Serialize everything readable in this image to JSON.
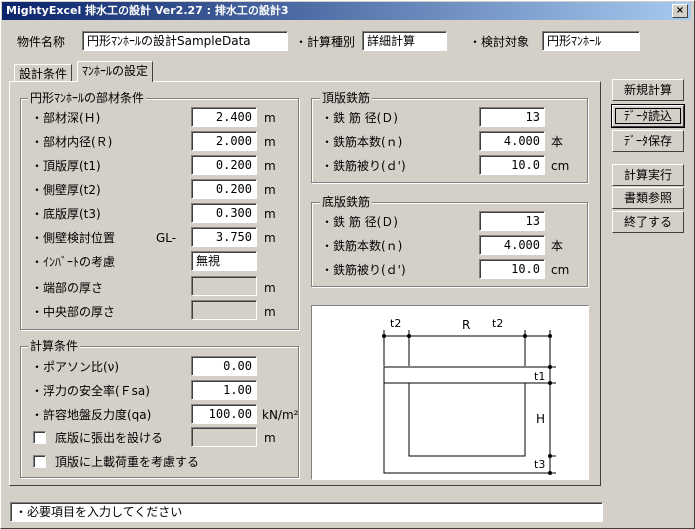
{
  "window": {
    "title": "MightyExcel 排水工の設計 Ver2.27 : 排水工の設計3",
    "close_glyph": "×"
  },
  "header": {
    "property_label": "物件名称",
    "property_value": "円形ﾏﾝﾎｰﾙの設計SampleData",
    "calc_type_label": "・計算種別",
    "calc_type_value": "詳細計算",
    "target_label": "・検討対象",
    "target_value": "円形ﾏﾝﾎｰﾙ"
  },
  "tabs": [
    {
      "label": "設計条件",
      "active": false
    },
    {
      "label": "ﾏﾝﾎｰﾙの設定",
      "active": true
    }
  ],
  "member_group": {
    "title": "円形ﾏﾝﾎｰﾙの部材条件",
    "rows": [
      {
        "label": "・部材深(Ｈ)",
        "value": "2.400",
        "unit": "m"
      },
      {
        "label": "・部材内径(Ｒ)",
        "value": "2.000",
        "unit": "m"
      },
      {
        "label": "・頂版厚(t1)",
        "value": "0.200",
        "unit": "m"
      },
      {
        "label": "・側壁厚(t2)",
        "value": "0.200",
        "unit": "m"
      },
      {
        "label": "・底版厚(t3)",
        "value": "0.300",
        "unit": "m"
      },
      {
        "label": "・側壁検討位置",
        "prefix": "GL-",
        "value": "3.750",
        "unit": "m"
      },
      {
        "label": "・ｲﾝﾊﾞｰﾄの考慮",
        "value": "無視",
        "unit": ""
      },
      {
        "label": "・端部の厚さ",
        "value": "",
        "unit": "m"
      },
      {
        "label": "・中央部の厚さ",
        "value": "",
        "unit": "m"
      }
    ]
  },
  "calc_group": {
    "title": "計算条件",
    "rows": [
      {
        "label": "・ポアソン比(ν)",
        "value": "0.00",
        "unit": ""
      },
      {
        "label": "・浮力の安全率(Ｆsa)",
        "value": "1.00",
        "unit": ""
      },
      {
        "label": "・許容地盤反力度(qa)",
        "value": "100.00",
        "unit": "kN/m²"
      }
    ],
    "check1_label": "底版に張出を設ける",
    "check1_unit": "m",
    "check2_label": "頂版に上載荷重を考慮する"
  },
  "top_rebar": {
    "title": "頂版鉄筋",
    "rows": [
      {
        "label": "・鉄 筋 径(Ｄ)",
        "value": "13",
        "unit": ""
      },
      {
        "label": "・鉄筋本数(ｎ)",
        "value": "4.000",
        "unit": "本"
      },
      {
        "label": "・鉄筋被り(ｄ')",
        "value": "10.0",
        "unit": "cm"
      }
    ]
  },
  "bottom_rebar": {
    "title": "底版鉄筋",
    "rows": [
      {
        "label": "・鉄 筋 径(Ｄ)",
        "value": "13",
        "unit": ""
      },
      {
        "label": "・鉄筋本数(ｎ)",
        "value": "4.000",
        "unit": "本"
      },
      {
        "label": "・鉄筋被り(ｄ')",
        "value": "10.0",
        "unit": "cm"
      }
    ]
  },
  "diagram": {
    "t1": "t1",
    "t2_left": "t2",
    "t2_right": "t2",
    "t3": "t3",
    "R": "R",
    "H": "H"
  },
  "buttons": {
    "new_calc": "新規計算",
    "load_data": "ﾃﾞｰﾀ読込",
    "save_data": "ﾃﾞｰﾀ保存",
    "run_calc": "計算実行",
    "browse_docs": "書類参照",
    "exit": "終了する"
  },
  "status": "・必要項目を入力してください"
}
